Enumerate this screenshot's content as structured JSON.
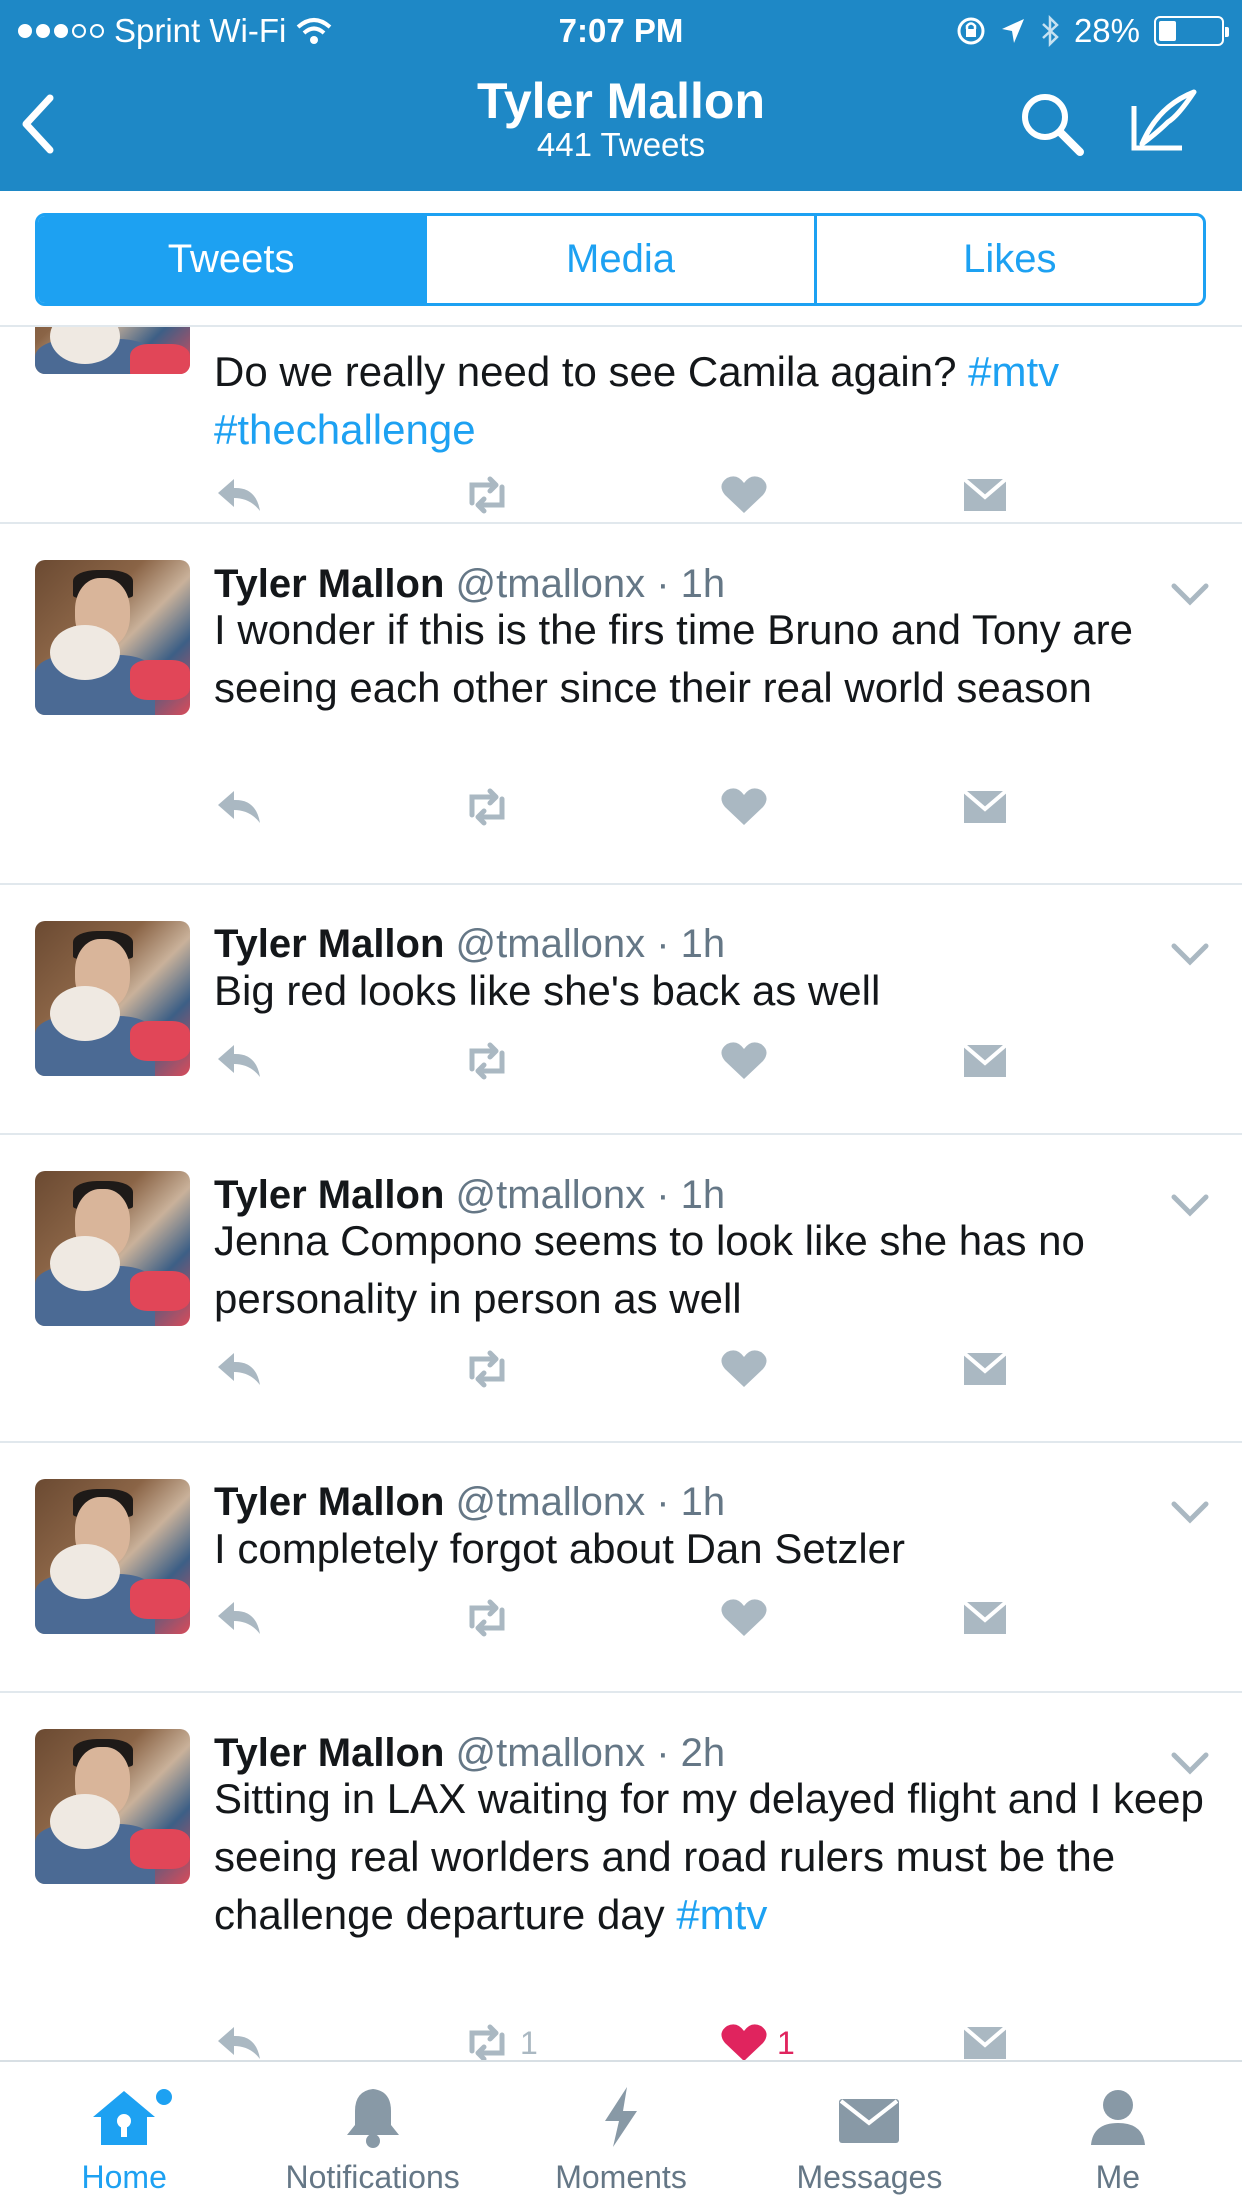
{
  "status_bar": {
    "carrier": "Sprint Wi-Fi",
    "time": "7:07 PM",
    "battery": "28%",
    "battery_level": 0.28,
    "signal_bars_filled": 3,
    "signal_bars_total": 5
  },
  "nav": {
    "title": "Tyler Mallon",
    "subtitle": "441 Tweets",
    "icons": [
      "back-icon",
      "search-icon",
      "compose-icon"
    ]
  },
  "segments": {
    "tabs": [
      {
        "label": "Tweets",
        "active": true
      },
      {
        "label": "Media",
        "active": false
      },
      {
        "label": "Likes",
        "active": false
      }
    ]
  },
  "tweets": [
    {
      "name": "",
      "handle": "",
      "time": "",
      "text_parts": [
        {
          "t": "Do we really need to see Camila again? ",
          "tag": false
        },
        {
          "t": "#mtv",
          "tag": true
        },
        {
          "t": " ",
          "tag": false
        },
        {
          "t": "#thechallenge",
          "tag": true
        }
      ],
      "retweets": "",
      "likes": "",
      "liked": false
    },
    {
      "name": "Tyler Mallon",
      "handle": "@tmallonx",
      "time": "1h",
      "text_parts": [
        {
          "t": "I wonder if this is the firs time Bruno and Tony are seeing each other since their real world season",
          "tag": false
        }
      ],
      "retweets": "",
      "likes": "",
      "liked": false
    },
    {
      "name": "Tyler Mallon",
      "handle": "@tmallonx",
      "time": "1h",
      "text_parts": [
        {
          "t": "Big red looks like she's back as well",
          "tag": false
        }
      ],
      "retweets": "",
      "likes": "",
      "liked": false
    },
    {
      "name": "Tyler Mallon",
      "handle": "@tmallonx",
      "time": "1h",
      "text_parts": [
        {
          "t": "Jenna Compono seems to look like she has no personality in person as well",
          "tag": false
        }
      ],
      "retweets": "",
      "likes": "",
      "liked": false
    },
    {
      "name": "Tyler Mallon",
      "handle": "@tmallonx",
      "time": "1h",
      "text_parts": [
        {
          "t": "I completely forgot about Dan Setzler",
          "tag": false
        }
      ],
      "retweets": "",
      "likes": "",
      "liked": false
    },
    {
      "name": "Tyler Mallon",
      "handle": "@tmallonx",
      "time": "2h",
      "text_parts": [
        {
          "t": "Sitting in LAX waiting for my delayed flight and I keep seeing real worlders and road rulers must be the challenge departure day ",
          "tag": false
        },
        {
          "t": "#mtv",
          "tag": true
        }
      ],
      "retweets": "1",
      "likes": "1",
      "liked": true
    }
  ],
  "tabbar": {
    "items": [
      {
        "label": "Home",
        "icon": "home-icon",
        "active": true,
        "badge": true
      },
      {
        "label": "Notifications",
        "icon": "bell-icon",
        "active": false,
        "badge": false
      },
      {
        "label": "Moments",
        "icon": "lightning-icon",
        "active": false,
        "badge": false
      },
      {
        "label": "Messages",
        "icon": "envelope-icon",
        "active": false,
        "badge": false
      },
      {
        "label": "Me",
        "icon": "person-icon",
        "active": false,
        "badge": false
      }
    ]
  },
  "colors": {
    "header": "#1e88c6",
    "accent": "#1da1f2",
    "action_icon": "#aab8c2",
    "like_active": "#e0245e",
    "text": "#14171a",
    "muted": "#657786"
  }
}
